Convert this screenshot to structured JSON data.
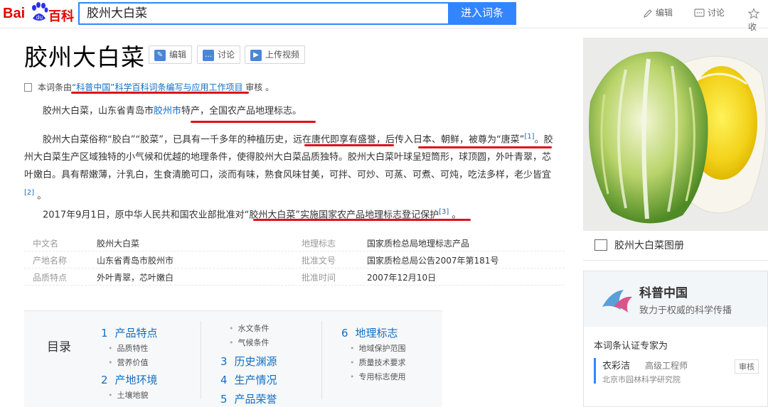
{
  "header": {
    "logo_bai": "Bai",
    "logo_baike": "百科",
    "search_value": "胶州大白菜",
    "search_button": "进入词条",
    "tools": {
      "edit": "编辑",
      "discuss": "讨论",
      "collect": "收"
    }
  },
  "article": {
    "title": "胶州大白菜",
    "actions": {
      "edit": "编辑",
      "discuss": "讨论",
      "upload_video": "上传视频"
    },
    "review": {
      "prefix": "本词条由",
      "link": "“科普中国”科学百科词条编写与应用工作项目",
      "suffix": " 审核 。"
    },
    "para1": {
      "t1": "胶州大白菜，山东省青岛市",
      "link": "胶州市",
      "t2": "特产，全国农产品地理标志。"
    },
    "para2": {
      "t1": "胶州大白菜俗称“胶白”“胶菜”，已具有一千多年的种植历史，远在唐代即享有盛誉，后传入日本、朝鲜，被尊为“唐菜”",
      "ref1": "[1]",
      "t2": "。胶州大白菜生产区域独特的小气候和优越的地理条件，使得胶州大白菜品质独特。胶州大白菜叶球呈短筒形，球顶圆，外叶青翠，芯叶嫩白。具有帮嫩薄，汁乳白，生食清脆可口，淡而有味，熟食风味甘美，可拌、可炒、可蒸、可煮、可炖，吃法多样，老少皆宜",
      "ref2": "[2]",
      "t3": " 。"
    },
    "para3": {
      "t1": "2017年9月1日，原中华人民共和国农业部批准对“胶州大白菜”实施国家农产品地理标志登记保护",
      "ref": "[3]",
      "t2": " 。"
    },
    "info": [
      {
        "k1": "中文名",
        "v1": "胶州大白菜",
        "k2": "地理标志",
        "v2": "国家质检总局地理标志产品"
      },
      {
        "k1": "产地名称",
        "v1": "山东省青岛市胶州市",
        "k2": "批准文号",
        "v2": "国家质检总局公告2007年第181号"
      },
      {
        "k1": "品质特点",
        "v1": "外叶青翠，芯叶嫩白",
        "k2": "批准时间",
        "v2": "2007年12月10日"
      }
    ]
  },
  "toc": {
    "label": "目录",
    "col1": {
      "h1": {
        "n": "1",
        "t": "产品特点"
      },
      "s1a": "品质特性",
      "s1b": "营养价值",
      "h2": {
        "n": "2",
        "t": "产地环境"
      },
      "s2a": "土壤地貌"
    },
    "col2": {
      "s2b": "水文条件",
      "s2c": "气候条件",
      "h3": {
        "n": "3",
        "t": "历史渊源"
      },
      "h4": {
        "n": "4",
        "t": "生产情况"
      },
      "h5": {
        "n": "5",
        "t": "产品荣誉"
      }
    },
    "col3": {
      "h6": {
        "n": "6",
        "t": "地理标志"
      },
      "s6a": "地域保护范围",
      "s6b": "质量技术要求",
      "s6c": "专用标志使用"
    }
  },
  "side": {
    "album": "胶州大白菜图册",
    "kepu": {
      "name": "科普中国",
      "slogan": "致力于权威的科学传播",
      "expert_label": "本词条认证专家为",
      "person": "衣彩洁",
      "person_title": "高级工程师",
      "org": "北京市园林科学研究院",
      "review": "审核"
    }
  },
  "colors": {
    "link": "#136ec2",
    "search": "#3385ff",
    "highlight": "#e0101a"
  }
}
